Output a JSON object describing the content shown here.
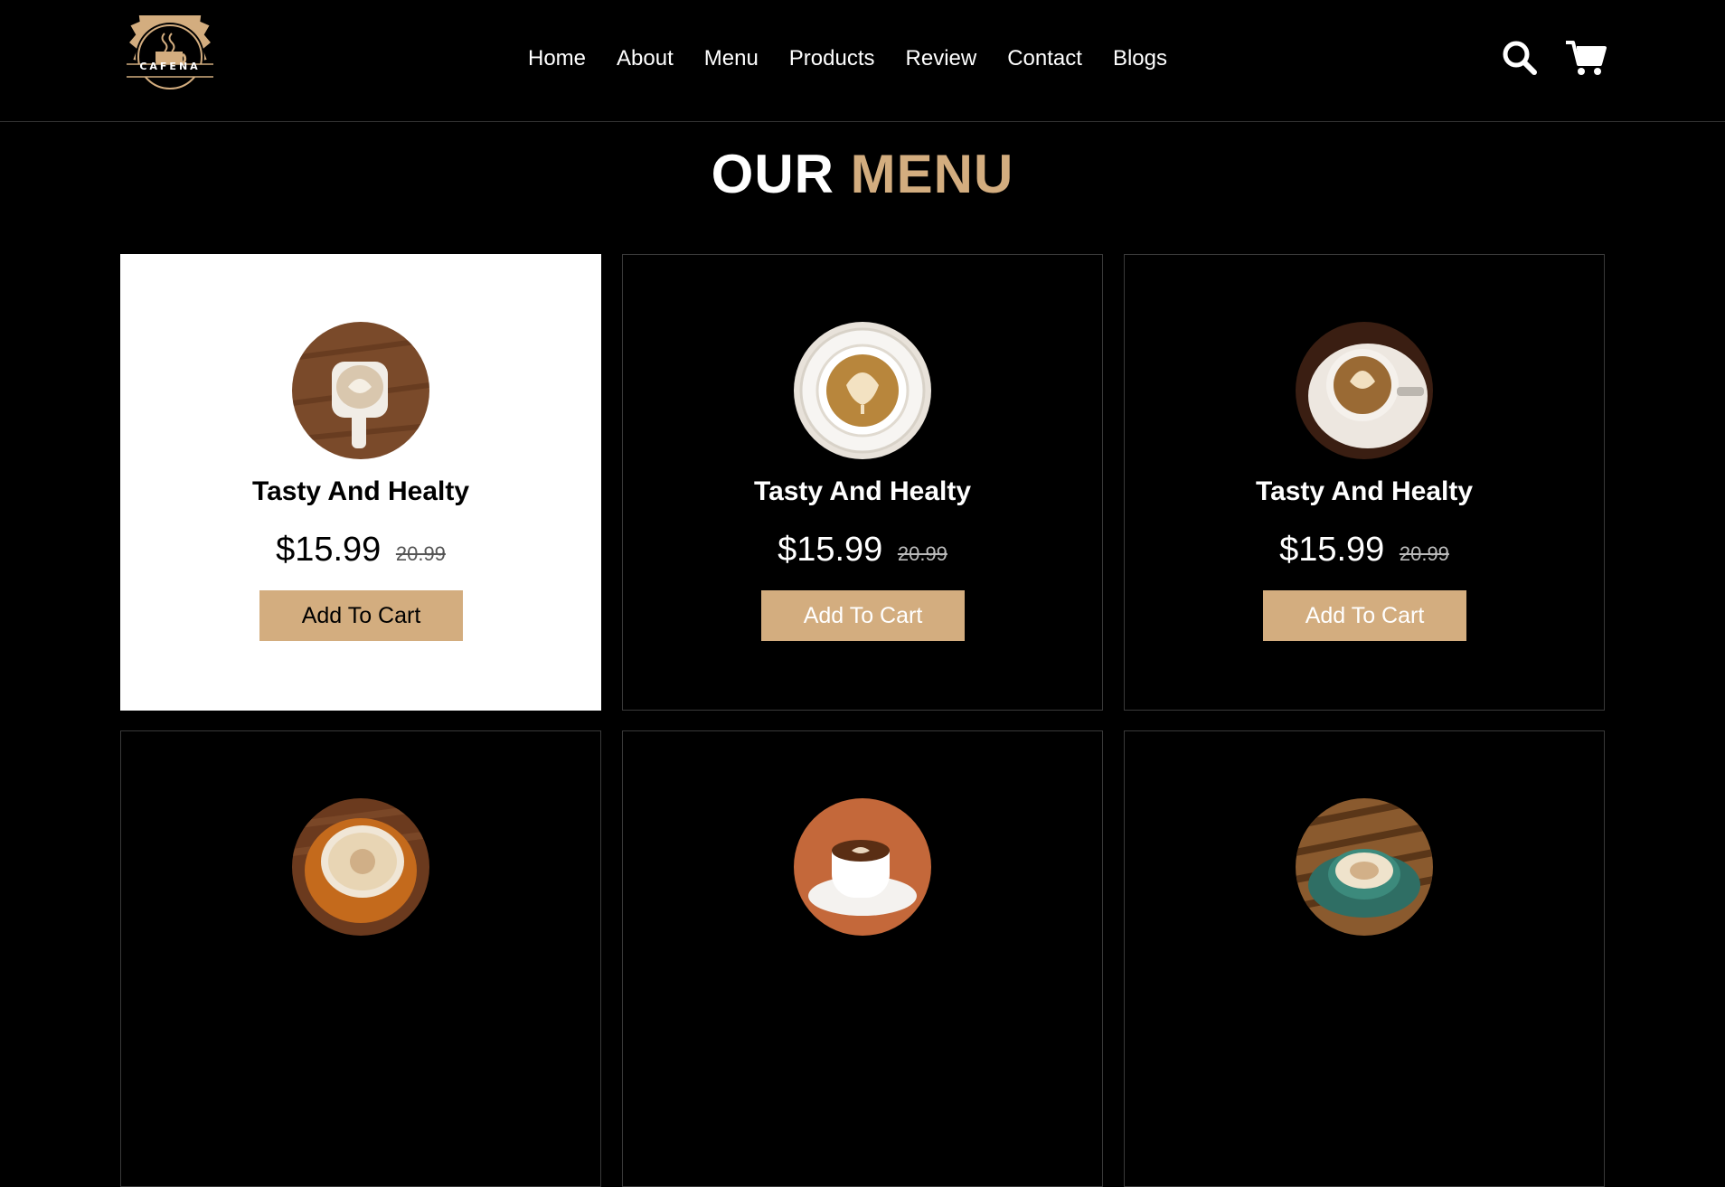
{
  "header": {
    "logo_text": "CAFENA",
    "nav": [
      {
        "label": "Home"
      },
      {
        "label": "About"
      },
      {
        "label": "Menu"
      },
      {
        "label": "Products"
      },
      {
        "label": "Review"
      },
      {
        "label": "Contact"
      },
      {
        "label": "Blogs"
      }
    ],
    "icons": {
      "search": "search-icon",
      "cart": "cart-icon"
    }
  },
  "section": {
    "title_part1": "OUR",
    "title_part2": "MENU"
  },
  "colors": {
    "background": "#000000",
    "accent": "#d3ad7f",
    "text": "#ffffff",
    "active_card_bg": "#ffffff"
  },
  "menu_items": [
    {
      "name": "Tasty And Healty",
      "price": "$15.99",
      "old_price": "20.99",
      "button": "Add To Cart",
      "active": true
    },
    {
      "name": "Tasty And Healty",
      "price": "$15.99",
      "old_price": "20.99",
      "button": "Add To Cart",
      "active": false
    },
    {
      "name": "Tasty And Healty",
      "price": "$15.99",
      "old_price": "20.99",
      "button": "Add To Cart",
      "active": false
    },
    {
      "name": "",
      "price": "",
      "old_price": "",
      "button": "",
      "active": false
    },
    {
      "name": "",
      "price": "",
      "old_price": "",
      "button": "",
      "active": false
    },
    {
      "name": "",
      "price": "",
      "old_price": "",
      "button": "",
      "active": false
    }
  ]
}
